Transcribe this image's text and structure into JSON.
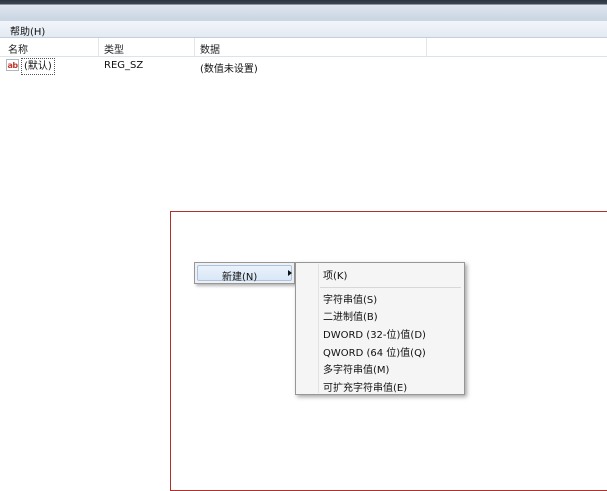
{
  "menubar": {
    "help": "帮助(H)"
  },
  "columns": {
    "name": "名称",
    "type": "类型",
    "data": "数据"
  },
  "rows": [
    {
      "icon": "ab",
      "name": "(默认)",
      "type": "REG_SZ",
      "data": "(数值未设置)"
    }
  ],
  "context_menu": {
    "new_label": "新建(N)",
    "submenu": {
      "key": "项(K)",
      "items": [
        "字符串值(S)",
        "二进制值(B)",
        "DWORD (32-位)值(D)",
        "QWORD (64 位)值(Q)",
        "多字符串值(M)",
        "可扩充字符串值(E)"
      ]
    }
  },
  "colors": {
    "highlight_box": "#b03030",
    "menu_hover": "#d9e7f7"
  }
}
